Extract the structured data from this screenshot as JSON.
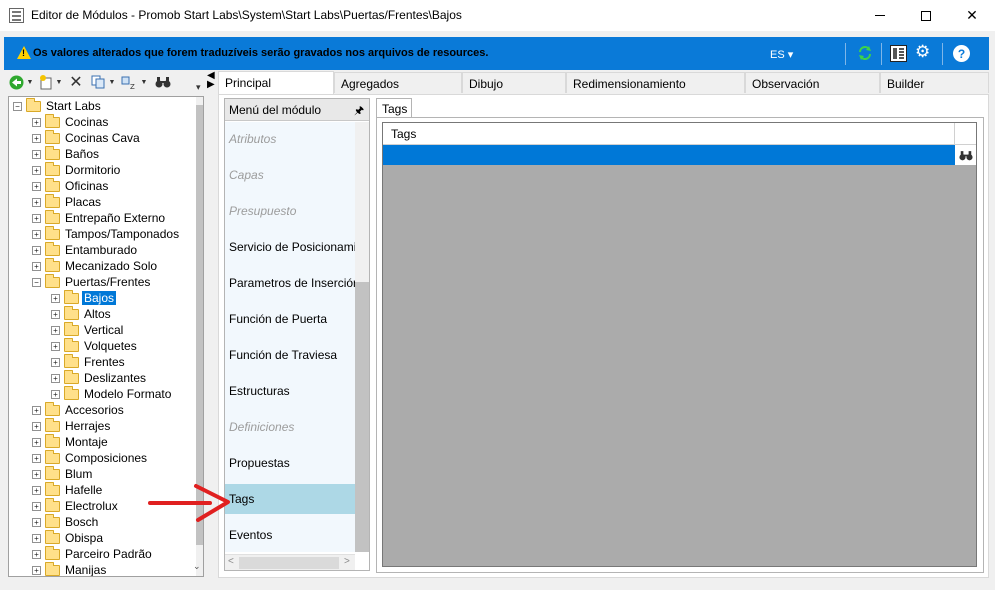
{
  "window": {
    "title": "Editor de Módulos - Promob Start Labs\\System\\Start Labs\\Puertas/Frentes\\Bajos",
    "minimize": "",
    "close": "✕"
  },
  "infobar": {
    "message": "Os valores alterados que forem traduzíveis serão gravados nos arquivos de resources.",
    "language": "ES ▾",
    "background_color": "#0a7ad8"
  },
  "tree_toolbar": {
    "icons": [
      "back-icon",
      "new-item-icon",
      "delete-icon",
      "copy-icon",
      "sort-icon",
      "find-icon"
    ]
  },
  "tree": {
    "root": "Start Labs",
    "items": [
      {
        "label": "Cocinas"
      },
      {
        "label": "Cocinas Cava"
      },
      {
        "label": "Baños"
      },
      {
        "label": "Dormitorio"
      },
      {
        "label": "Oficinas"
      },
      {
        "label": "Placas"
      },
      {
        "label": "Entrepaño Externo"
      },
      {
        "label": "Tampos/Tamponados"
      },
      {
        "label": "Entamburado"
      },
      {
        "label": "Mecanizado Solo"
      },
      {
        "label": "Puertas/Frentes"
      },
      {
        "label": "Accesorios"
      },
      {
        "label": "Herrajes"
      },
      {
        "label": "Montaje"
      },
      {
        "label": "Composiciones"
      },
      {
        "label": "Blum"
      },
      {
        "label": "Hafelle"
      },
      {
        "label": "Electrolux"
      },
      {
        "label": "Bosch"
      },
      {
        "label": "Obispa"
      },
      {
        "label": "Parceiro Padrão"
      },
      {
        "label": "Manijas"
      }
    ],
    "children": [
      {
        "label": "Bajos",
        "selected": true
      },
      {
        "label": "Altos"
      },
      {
        "label": "Vertical"
      },
      {
        "label": "Volquetes"
      },
      {
        "label": "Frentes"
      },
      {
        "label": "Deslizantes"
      },
      {
        "label": "Modelo Formato"
      }
    ]
  },
  "tabs": [
    "Principal",
    "Agregados",
    "Dibujo",
    "Redimensionamiento",
    "Observación",
    "Builder"
  ],
  "menu": {
    "header": "Menú del módulo",
    "items": [
      {
        "label": "Atributos",
        "enabled": false
      },
      {
        "label": "Capas",
        "enabled": false
      },
      {
        "label": "Presupuesto",
        "enabled": false
      },
      {
        "label": "Servicio de Posicionamiento",
        "enabled": true
      },
      {
        "label": "Parametros de Inserción",
        "enabled": true
      },
      {
        "label": "Función de Puerta",
        "enabled": true
      },
      {
        "label": "Función de Traviesa",
        "enabled": true
      },
      {
        "label": "Estructuras",
        "enabled": true
      },
      {
        "label": "Definiciones",
        "enabled": false
      },
      {
        "label": "Propuestas",
        "enabled": true
      },
      {
        "label": "Tags",
        "enabled": true,
        "selected": true
      },
      {
        "label": "Eventos",
        "enabled": true
      }
    ]
  },
  "tags_panel": {
    "tab_label": "Tags",
    "column_header": "Tags",
    "selected_row_color": "#0078d7"
  }
}
